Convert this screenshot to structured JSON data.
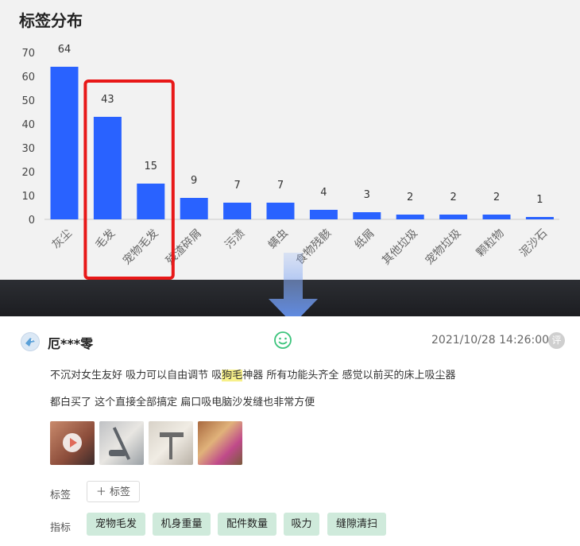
{
  "chart_data": {
    "type": "bar",
    "title": "标签分布",
    "categories": [
      "灰尘",
      "毛发",
      "宠物毛发",
      "残渣碎屑",
      "污渍",
      "螨虫",
      "食物残骸",
      "纸屑",
      "其他垃圾",
      "宠物垃圾",
      "颗粒物",
      "泥沙石"
    ],
    "values": [
      64,
      43,
      15,
      9,
      7,
      7,
      4,
      3,
      2,
      2,
      2,
      1
    ],
    "yticks": [
      0,
      10,
      20,
      30,
      40,
      50,
      60,
      70
    ],
    "ylim": [
      0,
      70
    ],
    "bar_color": "#2962ff",
    "highlight_box": {
      "categories": [
        "毛发",
        "宠物毛发"
      ],
      "color": "#e81818"
    },
    "grid": false
  },
  "arrow_color": "#6e9bf2",
  "review": {
    "username": "厄***零",
    "date": "2021/10/28 14:26:00",
    "ping_icon_text": "评",
    "mood_icon": "smile-icon",
    "text_line1_before": "不沉对女生友好 吸力可以自由调节 吸",
    "text_line1_highlight": "狗毛",
    "text_line1_after": "神器 所有功能头齐全 感觉以前买的床上吸尘器",
    "text_line2": "都白买了 这个直接全部搞定 扁口吸电脑沙发缝也非常方便",
    "tags_label": "标签",
    "add_tag_label": "＋ 标签",
    "indicators_label": "指标",
    "indicators": [
      "宠物毛发",
      "机身重量",
      "配件数量",
      "吸力",
      "缝隙清扫"
    ],
    "chip_color": "#cfeadb"
  }
}
